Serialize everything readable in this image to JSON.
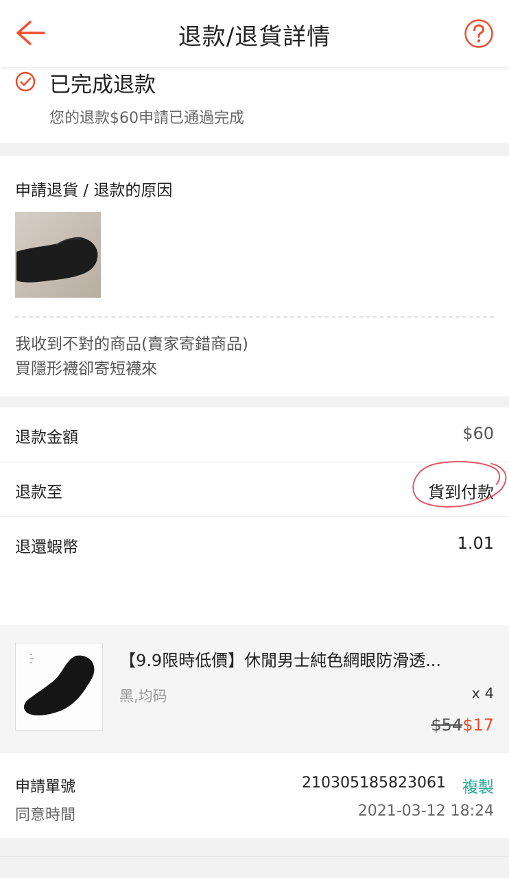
{
  "header": {
    "title": "退款/退貨詳情"
  },
  "status": {
    "title": "已完成退款",
    "subtitle": "您的退款$60申請已通過完成"
  },
  "reason": {
    "label": "申請退貨 / 退款的原因",
    "line1": "我收到不對的商品(賣家寄錯商品)",
    "line2": "買隱形襪卻寄短襪來"
  },
  "info": {
    "amount_label": "退款金額",
    "amount_value": "$60",
    "refund_to_label": "退款至",
    "refund_to_value": "貨到付款",
    "coins_label": "退還蝦幣",
    "coins_value": "1.01"
  },
  "product": {
    "name": "【9.9限時低價】休閒男士純色網眼防滑透...",
    "variant": "黑,均码",
    "quantity": "x 4",
    "original_price": "$54",
    "price": "$17"
  },
  "details": {
    "number_label": "申請單號",
    "number_value": "210305185823061",
    "copy_label": "複製",
    "time_label": "同意時間",
    "time_value": "2021-03-12 18:24"
  },
  "colors": {
    "brand": "#ee4d2d",
    "copy": "#26aa99",
    "annotation": "#e03a4a"
  },
  "icons": {
    "back": "back-arrow-icon",
    "help": "help-circle-icon",
    "status": "check-circle-icon"
  }
}
